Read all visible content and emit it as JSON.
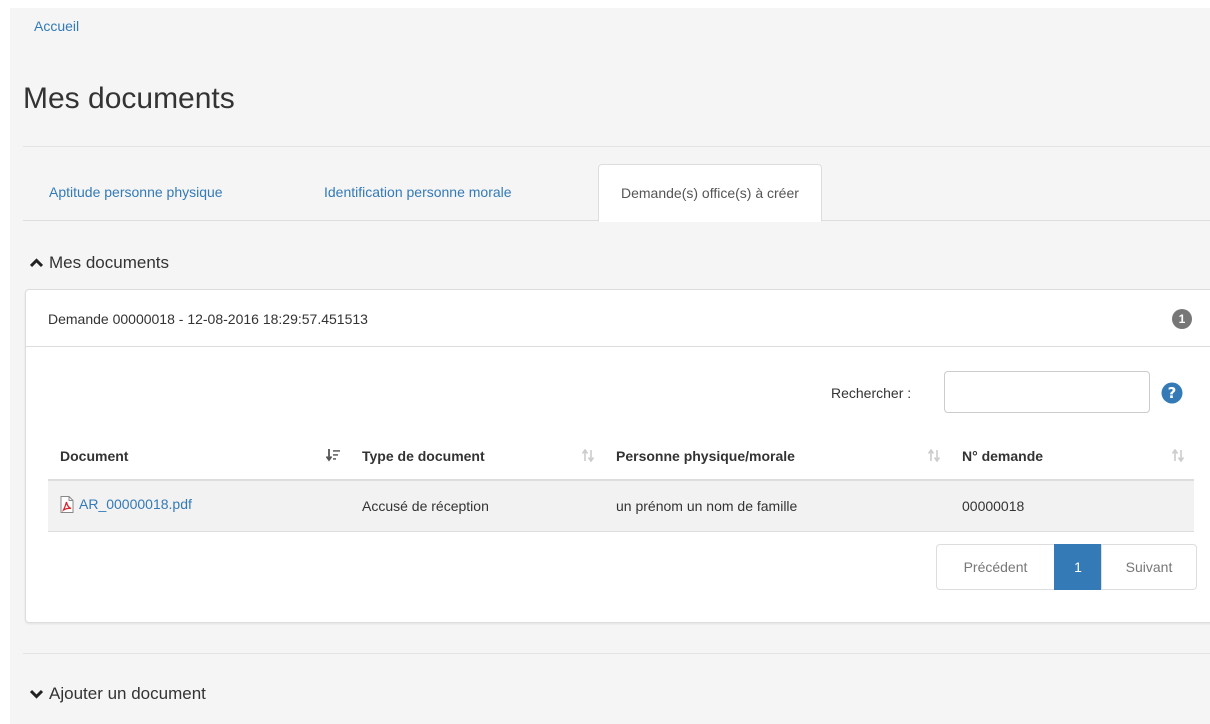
{
  "breadcrumb": {
    "home": "Accueil"
  },
  "page": {
    "title": "Mes documents"
  },
  "tabs": [
    {
      "label": "Aptitude personne physique",
      "active": false
    },
    {
      "label": "Identification personne morale",
      "active": false
    },
    {
      "label": "Demande(s) office(s) à créer",
      "active": true
    }
  ],
  "sections": {
    "mes_documents": {
      "label": "Mes documents",
      "state": "expanded"
    },
    "ajouter": {
      "label": "Ajouter un document",
      "state": "collapsed"
    }
  },
  "panel": {
    "title": "Demande 00000018 - 12-08-2016 18:29:57.451513",
    "badge": "1"
  },
  "search": {
    "label": "Rechercher :",
    "value": "",
    "placeholder": ""
  },
  "table": {
    "columns": [
      "Document",
      "Type de document",
      "Personne physique/morale",
      "N° demande"
    ],
    "rows": [
      {
        "document": "AR_00000018.pdf",
        "type": "Accusé de réception",
        "personne": "un prénom un nom de famille",
        "numero": "00000018"
      }
    ]
  },
  "pagination": {
    "previous": "Précédent",
    "current": "1",
    "next": "Suivant"
  },
  "colors": {
    "link": "#337ab7",
    "active_page": "#337ab7",
    "badge": "#777777"
  },
  "icons": [
    "chevron-up-icon",
    "chevron-down-icon",
    "sort-icon",
    "sort-ascending-icon",
    "pdf-file-icon",
    "question-circle-icon"
  ]
}
